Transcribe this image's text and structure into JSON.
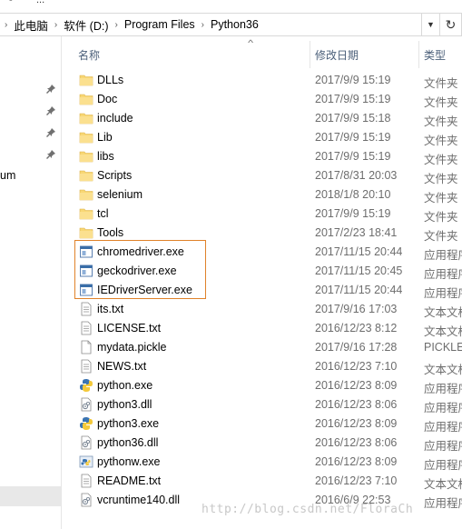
{
  "top_partial": {
    "left_text": "-",
    "right_text": "..."
  },
  "breadcrumb": {
    "items": [
      "此电脑",
      "软件 (D:)",
      "Program Files",
      "Python36"
    ],
    "separator": "›"
  },
  "nav": {
    "partial_label": "um"
  },
  "columns": {
    "name": "名称",
    "date": "修改日期",
    "type": "类型"
  },
  "files": [
    {
      "name": "DLLs",
      "date": "2017/9/9 15:19",
      "type": "文件夹",
      "icon": "folder-icon"
    },
    {
      "name": "Doc",
      "date": "2017/9/9 15:19",
      "type": "文件夹",
      "icon": "folder-icon"
    },
    {
      "name": "include",
      "date": "2017/9/9 15:18",
      "type": "文件夹",
      "icon": "folder-icon"
    },
    {
      "name": "Lib",
      "date": "2017/9/9 15:19",
      "type": "文件夹",
      "icon": "folder-icon"
    },
    {
      "name": "libs",
      "date": "2017/9/9 15:19",
      "type": "文件夹",
      "icon": "folder-icon"
    },
    {
      "name": "Scripts",
      "date": "2017/8/31 20:03",
      "type": "文件夹",
      "icon": "folder-icon"
    },
    {
      "name": "selenium",
      "date": "2018/1/8 20:10",
      "type": "文件夹",
      "icon": "folder-icon"
    },
    {
      "name": "tcl",
      "date": "2017/9/9 15:19",
      "type": "文件夹",
      "icon": "folder-icon"
    },
    {
      "name": "Tools",
      "date": "2017/2/23 18:41",
      "type": "文件夹",
      "icon": "folder-icon"
    },
    {
      "name": "chromedriver.exe",
      "date": "2017/11/15 20:44",
      "type": "应用程序",
      "icon": "exe-icon"
    },
    {
      "name": "geckodriver.exe",
      "date": "2017/11/15 20:45",
      "type": "应用程序",
      "icon": "exe-icon"
    },
    {
      "name": "IEDriverServer.exe",
      "date": "2017/11/15 20:44",
      "type": "应用程序",
      "icon": "exe-icon"
    },
    {
      "name": "its.txt",
      "date": "2017/9/16 17:03",
      "type": "文本文档",
      "icon": "text-file-icon"
    },
    {
      "name": "LICENSE.txt",
      "date": "2016/12/23 8:12",
      "type": "文本文档",
      "icon": "text-file-icon"
    },
    {
      "name": "mydata.pickle",
      "date": "2017/9/16 17:28",
      "type": "PICKLE",
      "icon": "blank-file-icon"
    },
    {
      "name": "NEWS.txt",
      "date": "2016/12/23 7:10",
      "type": "文本文档",
      "icon": "text-file-icon"
    },
    {
      "name": "python.exe",
      "date": "2016/12/23 8:09",
      "type": "应用程序",
      "icon": "python-icon"
    },
    {
      "name": "python3.dll",
      "date": "2016/12/23 8:06",
      "type": "应用程序",
      "icon": "dll-icon"
    },
    {
      "name": "python3.exe",
      "date": "2016/12/23 8:09",
      "type": "应用程序",
      "icon": "python-icon"
    },
    {
      "name": "python36.dll",
      "date": "2016/12/23 8:06",
      "type": "应用程序",
      "icon": "dll-icon"
    },
    {
      "name": "pythonw.exe",
      "date": "2016/12/23 8:09",
      "type": "应用程序",
      "icon": "pythonw-icon"
    },
    {
      "name": "README.txt",
      "date": "2016/12/23 7:10",
      "type": "文本文档",
      "icon": "text-file-icon"
    },
    {
      "name": "vcruntime140.dll",
      "date": "2016/6/9 22:53",
      "type": "应用程序",
      "icon": "dll-icon"
    }
  ],
  "watermark": "http://blog.csdn.net/FloraCh",
  "colors": {
    "folder": "#f7d675",
    "highlight_box": "#e0822a",
    "header_text": "#4c607a",
    "meta_text": "#6d6d6d"
  }
}
